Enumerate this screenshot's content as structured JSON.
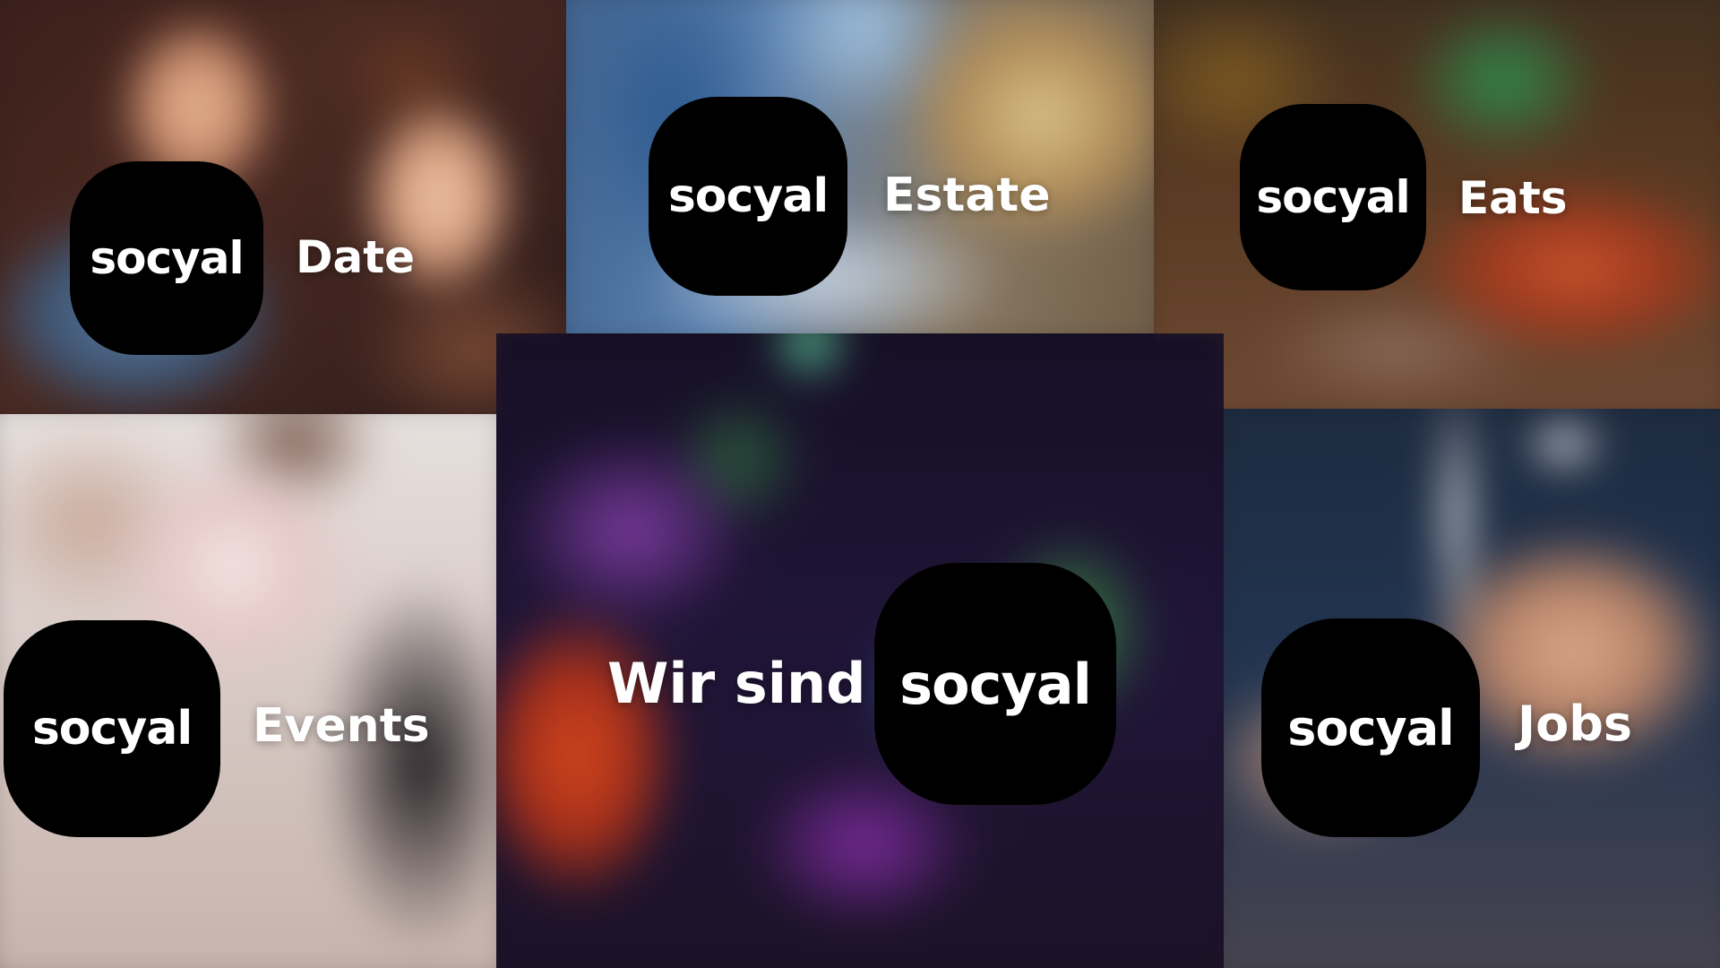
{
  "tiles": [
    {
      "id": "date",
      "brand": "socyal",
      "label": "Date",
      "accent": "#000000"
    },
    {
      "id": "estate",
      "brand": "socyal",
      "label": "Estate",
      "accent": "#000000"
    },
    {
      "id": "eats",
      "brand": "socyal",
      "label": "Eats",
      "accent": "#000000"
    },
    {
      "id": "events",
      "brand": "socyal",
      "label": "Events",
      "accent": "#000000"
    },
    {
      "id": "center",
      "brand": "socyal",
      "label": "Wir sind",
      "accent": "#000000"
    },
    {
      "id": "jobs",
      "brand": "socyal",
      "label": "Jobs",
      "accent": "#000000"
    }
  ],
  "colors": {
    "badge_bg": "#000000",
    "text": "#ffffff"
  }
}
